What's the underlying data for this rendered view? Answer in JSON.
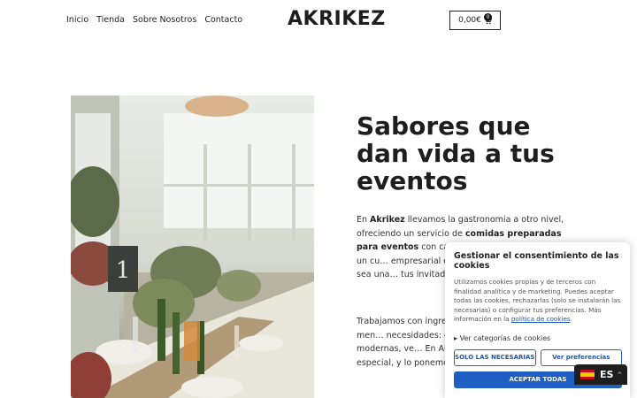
{
  "header": {
    "nav": [
      "Inicio",
      "Tienda",
      "Sobre Nosotros",
      "Contacto"
    ],
    "logo": "AKRIKEZ",
    "cart_total": "0,00€",
    "cart_count": "0"
  },
  "hero": {
    "title": "Sabores que dan vida a tus eventos",
    "p1": {
      "pre": "En ",
      "brand": "Akrikez",
      "mid": " llevamos la gastronomía a otro nivel, ofreciendo un servicio de ",
      "bold": "comidas preparadas para eventos",
      "post": " con calidad, s… Ya sea una boda, un cu… empresarial o una reun… que cada plato sea una… tus invitados."
    },
    "p2": "Trabajamos con ingredi… calidad, diseñando men… necesidades: desde pro… opciones modernas, ve… En Akrikez creemos que… especial, y lo ponemos en cada detalle."
  },
  "cookie": {
    "title": "Gestionar el consentimiento de las cookies",
    "text": "Utilizamos cookies propias y de terceros con finalidad analítica y de marketing. Puedes aceptar todas las cookies, rechazarlas (solo se instalarán las necesarias) o configurar tus preferencias. Más información en la ",
    "link": "política de cookies",
    "text_end": ".",
    "details": "Ver categorías de cookies",
    "btn_necessary": "SOLO LAS NECESARIAS",
    "btn_prefs": "Ver preferencias",
    "btn_accept": "ACEPTAR TODAS"
  },
  "language": {
    "code": "ES",
    "icon": "spain-flag-icon"
  }
}
